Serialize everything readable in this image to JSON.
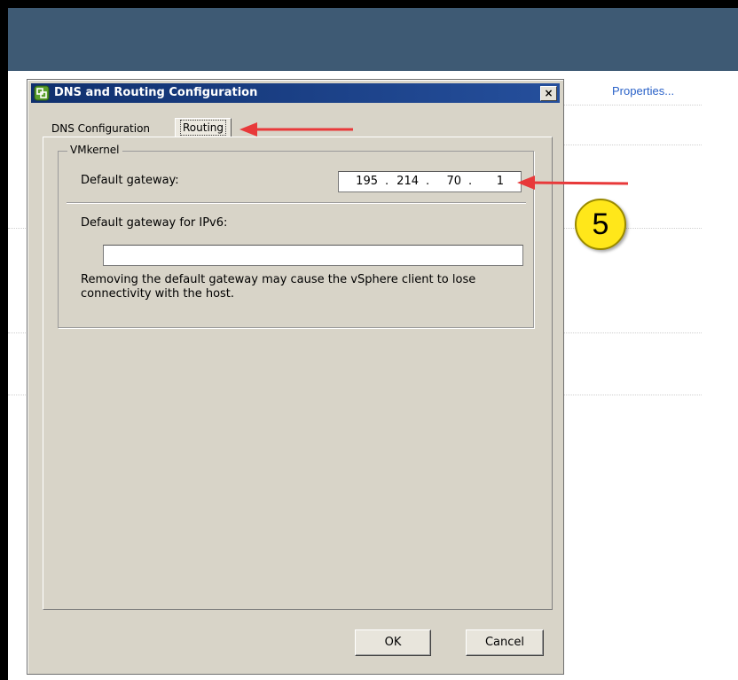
{
  "background": {
    "properties_link": "Properties..."
  },
  "dialog": {
    "title": "DNS and Routing Configuration",
    "close_label": "×",
    "tabs": [
      {
        "label": "DNS Configuration",
        "selected": false
      },
      {
        "label": "Routing",
        "selected": true
      }
    ],
    "group_title": "VMkernel",
    "default_gateway_label": "Default gateway:",
    "default_gateway": [
      "195",
      "214",
      "70",
      "1"
    ],
    "ipv6_label": "Default gateway for IPv6:",
    "ipv6_value": "",
    "warning": "Removing the default gateway may cause the vSphere client to lose connectivity with the host.",
    "ok_label": "OK",
    "cancel_label": "Cancel"
  },
  "annotation": {
    "step_number": "5",
    "arrow_color": "#e8393a"
  },
  "colors": {
    "banner": "#3e5a74",
    "titlebar": "#10306e",
    "dialog_bg": "#d8d4c8",
    "link": "#2a62c8"
  }
}
